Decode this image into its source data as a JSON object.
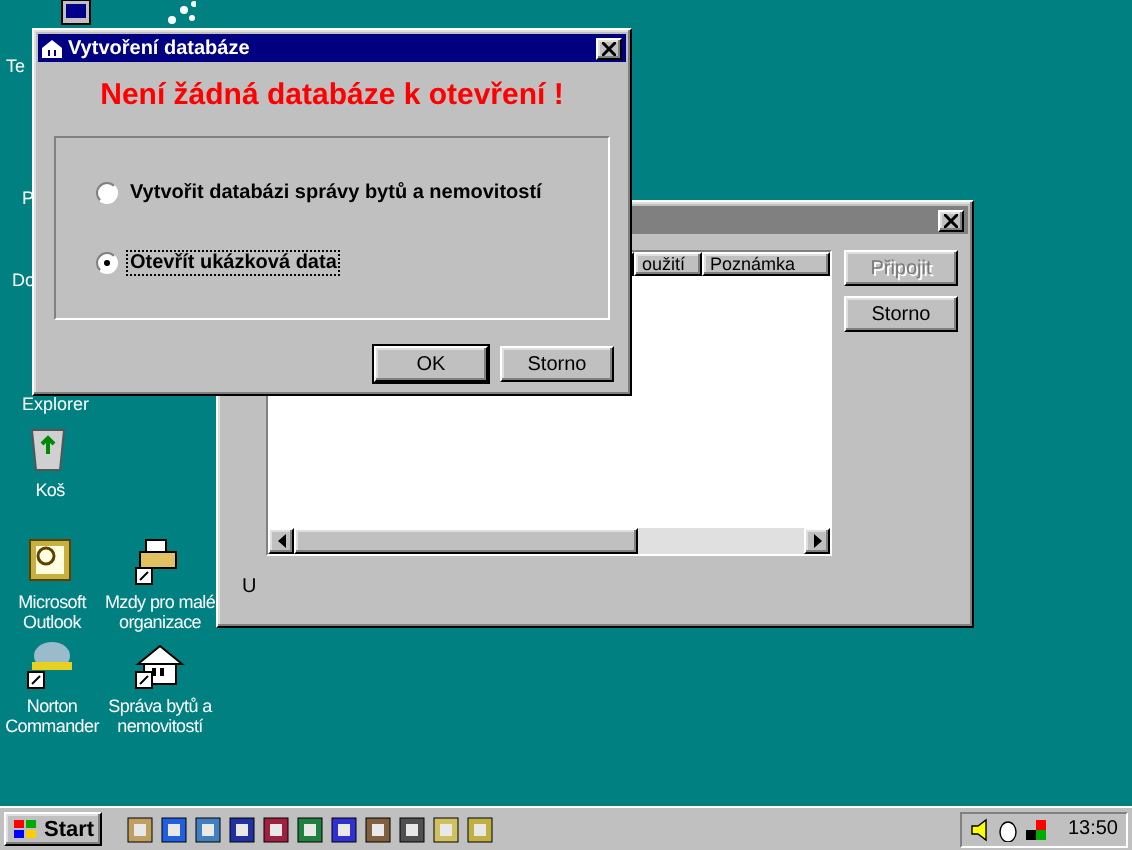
{
  "desktop_icons": [
    {
      "kind": "computer"
    },
    {
      "kind": "network"
    },
    {
      "label": "Te",
      "kind": "hidden"
    },
    {
      "label": "P",
      "kind": "hidden"
    },
    {
      "label": "Do",
      "kind": "hidden"
    },
    {
      "label": "Explorer",
      "kind": "hidden"
    },
    {
      "label": "Koš",
      "kind": "recycle"
    },
    {
      "label": "Microsoft Outlook",
      "kind": "outlook"
    },
    {
      "label": "Mzdy pro malé organizace",
      "kind": "printer"
    },
    {
      "label": "Norton Commander",
      "kind": "norton"
    },
    {
      "label": "Správa bytů a nemovitostí",
      "kind": "house"
    }
  ],
  "background_window": {
    "columns": [
      "oužití",
      "Poznámka"
    ],
    "buttons": [
      {
        "label": "Připojit",
        "disabled": true
      },
      {
        "label": "Storno",
        "disabled": false
      }
    ],
    "footer_label": "U"
  },
  "dialog": {
    "title": "Vytvoření databáze",
    "heading": "Není žádná databáze k otevření !",
    "options": [
      {
        "label": "Vytvořit databázi správy bytů a nemovitostí",
        "selected": false
      },
      {
        "label": "Otevřít ukázková data",
        "selected": true
      }
    ],
    "buttons": [
      "OK",
      "Storno"
    ]
  },
  "taskbar": {
    "start": "Start",
    "clock": "13:50"
  }
}
